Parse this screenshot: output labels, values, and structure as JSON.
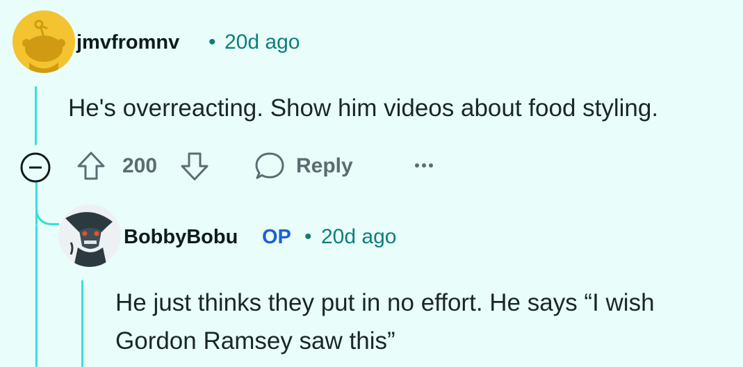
{
  "comment": {
    "username": "jmvfromnv",
    "separator": "•",
    "time": "20d ago",
    "body": "He's overreacting. Show him videos about food styling.",
    "score": "200",
    "reply_label": "Reply",
    "more_label": "···",
    "avatar_icon": "snoo-avatar-icon",
    "avatar_color": "#f4c430"
  },
  "reply": {
    "username": "BobbyBobu",
    "op_badge": "OP",
    "separator": "•",
    "time": "20d ago",
    "body_line1": "He just thinks they put in no effort. He says “I wish",
    "body_line2": "Gordon Ramsey saw this”",
    "avatar_icon": "alien-avatar-icon"
  },
  "colors": {
    "background": "#e9fdfa",
    "thread_line": "#33e0d8",
    "meta_text": "#0e7e78",
    "op_badge": "#1d5fd6",
    "action_gray": "#5c6c70"
  }
}
